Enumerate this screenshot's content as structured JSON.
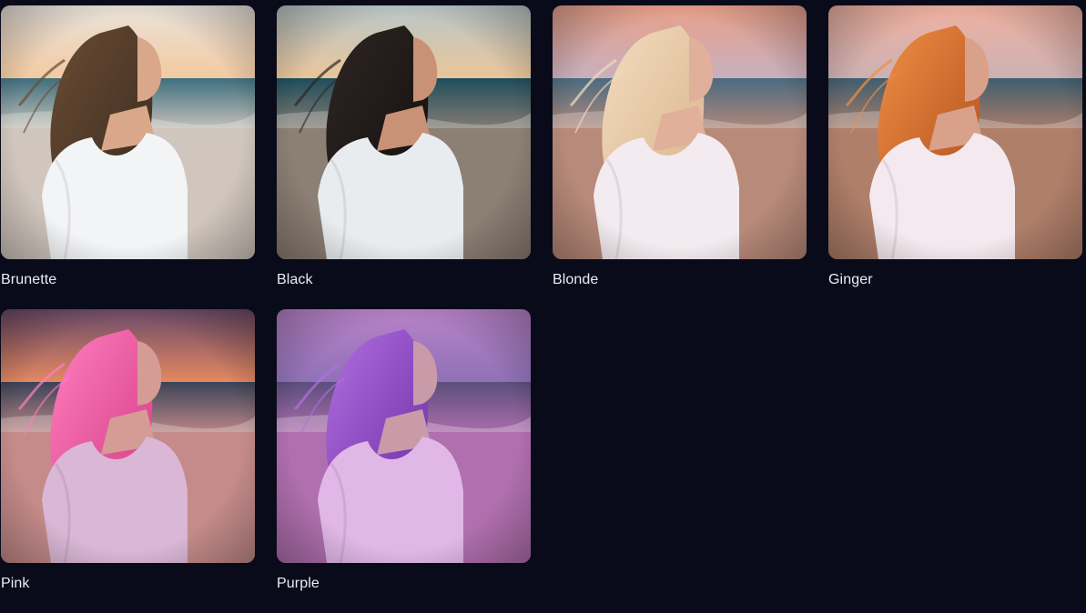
{
  "gallery": {
    "items": [
      {
        "label": "Brunette",
        "sky_top": "#e9e3db",
        "sky_bottom": "#f4c79a",
        "sea": "#3f6f7f",
        "sand": "#cfc6bd",
        "hair": "#3a2a1f",
        "hair_light": "#6b4d35",
        "dress": "#f3f4f6",
        "skin": "#d9a88a"
      },
      {
        "label": "Black",
        "sky_top": "#b9c7c9",
        "sky_bottom": "#f0c594",
        "sea": "#1f4e5d",
        "sand": "#8c7f74",
        "hair": "#120f0e",
        "hair_light": "#2f2623",
        "dress": "#e9ecef",
        "skin": "#c99277"
      },
      {
        "label": "Blonde",
        "sky_top": "#e8a08a",
        "sky_bottom": "#c4b1c4",
        "sea": "#4a6b80",
        "sand": "#b88a7a",
        "hair": "#d9b48a",
        "hair_light": "#f3dcc0",
        "dress": "#f3ebef",
        "skin": "#e0b09a"
      },
      {
        "label": "Ginger",
        "sky_top": "#efb1a0",
        "sky_bottom": "#c8b1b6",
        "sea": "#3f5d6e",
        "sand": "#b07f6a",
        "hair": "#b04d1c",
        "hair_light": "#f09046",
        "dress": "#f3e9ee",
        "skin": "#d9a08a"
      },
      {
        "label": "Pink",
        "sky_top": "#6b4a6a",
        "sky_bottom": "#f3905e",
        "sea": "#3b4357",
        "sand": "#c48b8a",
        "hair": "#d43b84",
        "hair_light": "#ff7fc0",
        "dress": "#d9b7d5",
        "skin": "#d59c95"
      },
      {
        "label": "Purple",
        "sky_top": "#b883c8",
        "sky_bottom": "#8a6fb4",
        "sea": "#5b4f7c",
        "sand": "#b06fae",
        "hair": "#6b2fa5",
        "hair_light": "#b26fe0",
        "dress": "#e0b7e6",
        "skin": "#c99aa8"
      }
    ]
  }
}
